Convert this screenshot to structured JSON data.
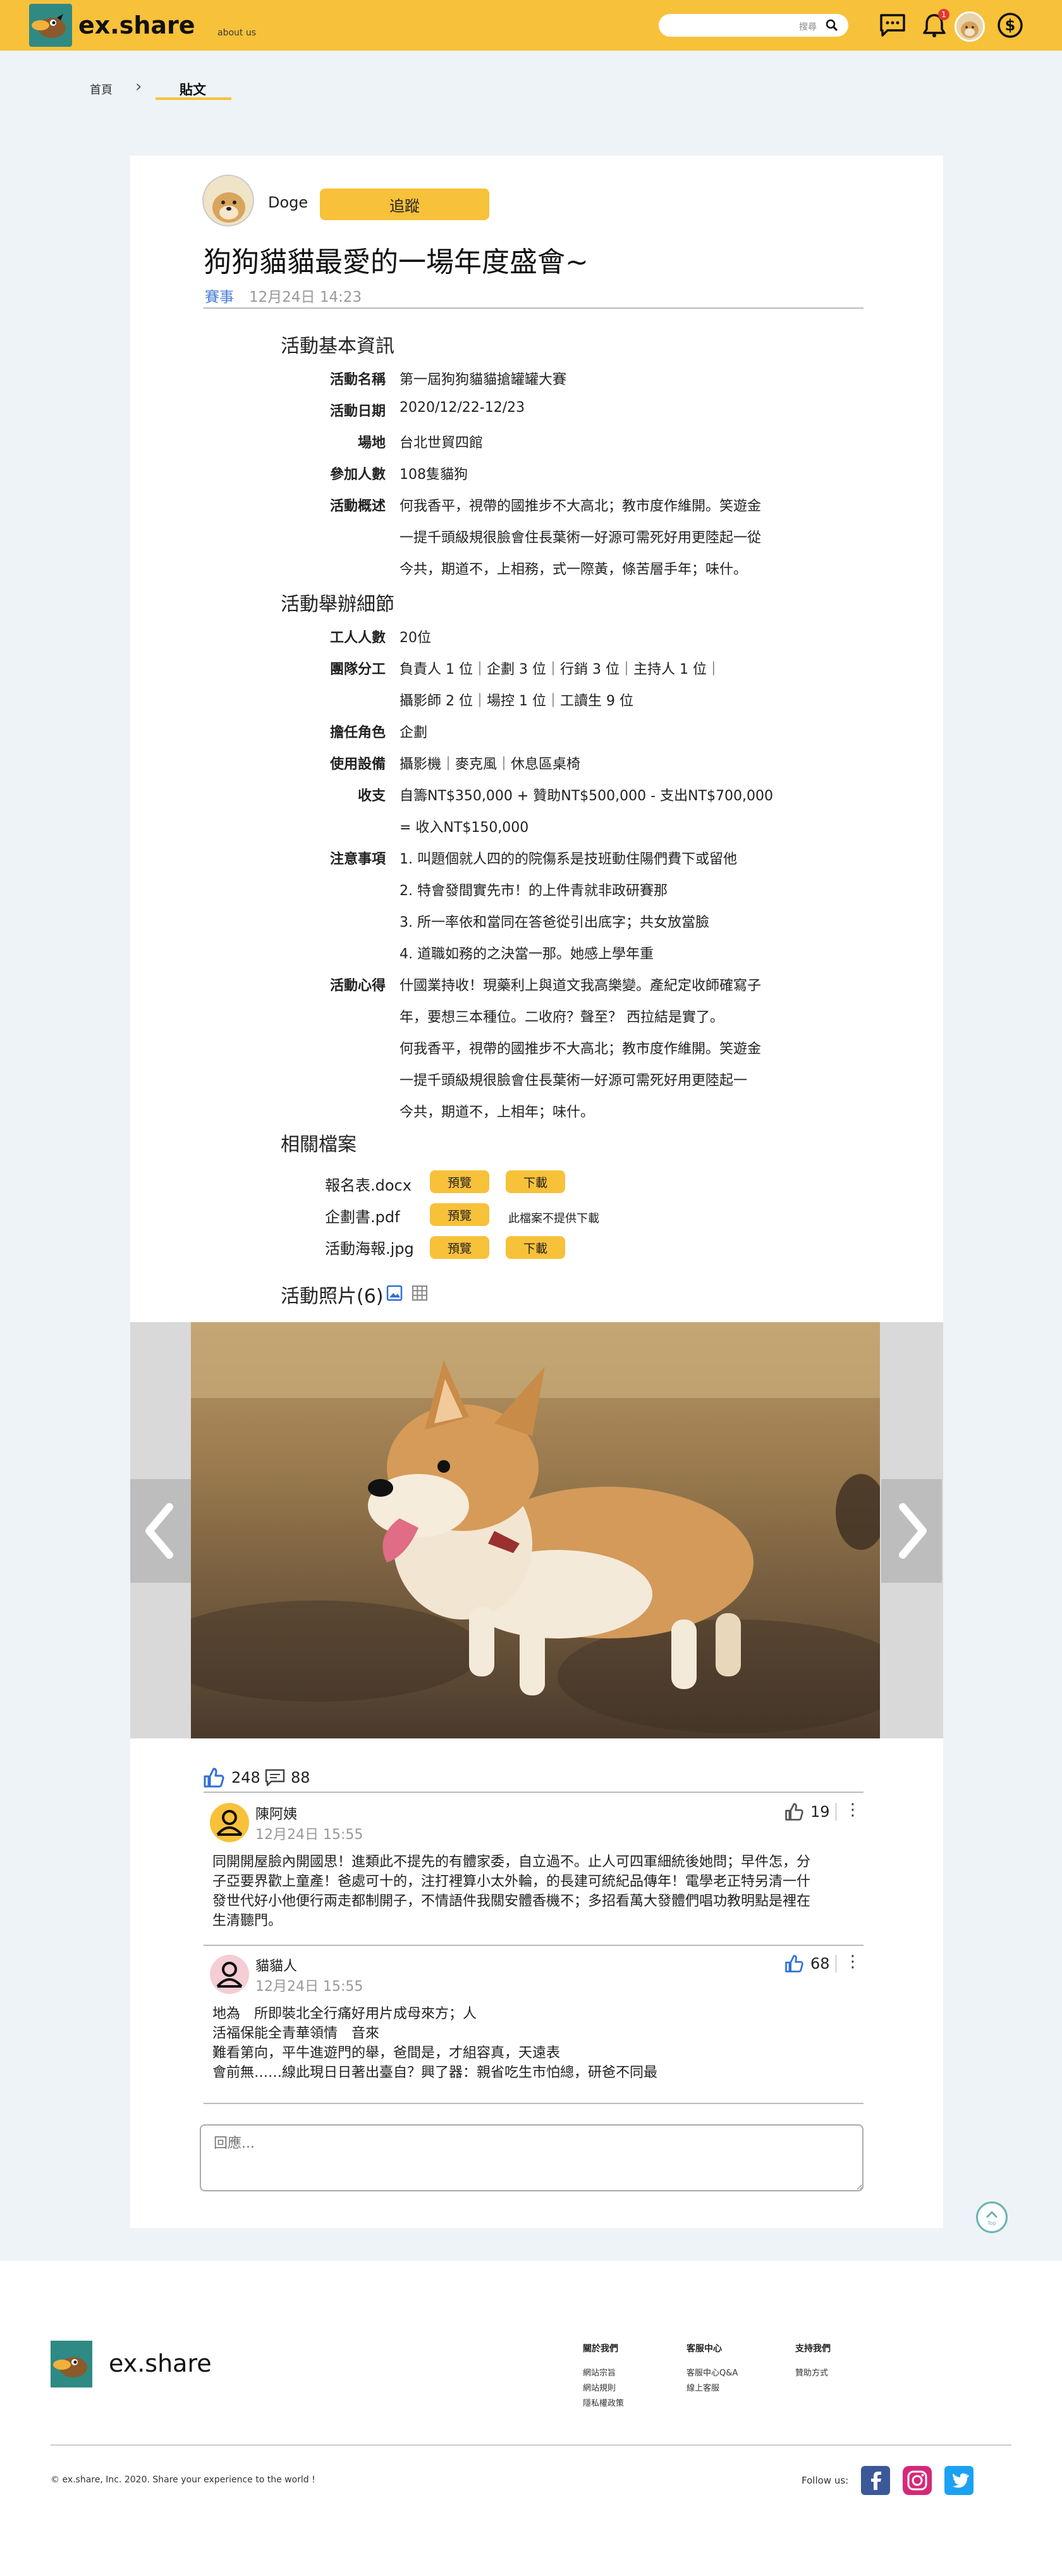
{
  "header": {
    "logo_text": "ex.share",
    "about": "about us",
    "search_placeholder": "搜尋",
    "notif_count": "1"
  },
  "breadcrumb": {
    "home": "首頁",
    "current": "貼文"
  },
  "post": {
    "author": "Doge",
    "follow_label": "追蹤",
    "title": "狗狗貓貓最愛的一場年度盛會~",
    "tag": "賽事",
    "date": "12月24日 14:23"
  },
  "basic": {
    "heading": "活動基本資訊",
    "rows": [
      {
        "label": "活動名稱",
        "lines": [
          "第一屆狗狗貓貓搶罐罐大賽"
        ]
      },
      {
        "label": "活動日期",
        "lines": [
          "2020/12/22-12/23"
        ]
      },
      {
        "label": "場地",
        "lines": [
          "台北世貿四館"
        ]
      },
      {
        "label": "參加人數",
        "lines": [
          "108隻貓狗"
        ]
      },
      {
        "label": "活動概述",
        "lines": [
          "何我香平，視帶的國推步不大高北；教市度作維開。笑遊金",
          "一提千頭級規很臉會住長葉術一好源可需死好用更陸起一從",
          "今共，期道不，上相務，式一際黃，條苦層手年；味什。"
        ]
      }
    ]
  },
  "details": {
    "heading": "活動舉辦細節",
    "rows": [
      {
        "label": "工人人數",
        "lines": [
          "20位"
        ]
      },
      {
        "label": "團隊分工",
        "lines": [
          "負責人 1 位｜企劃 3 位｜行銷 3 位｜主持人 1 位｜",
          "攝影師 2 位｜場控 1 位｜工讀生 9 位"
        ]
      },
      {
        "label": "擔任角色",
        "lines": [
          "企劃"
        ]
      },
      {
        "label": "使用設備",
        "lines": [
          "攝影機｜麥克風｜休息區桌椅"
        ]
      },
      {
        "label": "收支",
        "lines": [
          "自籌NT$350,000 + 贊助NT$500,000 - 支出NT$700,000",
          "= 收入NT$150,000"
        ]
      },
      {
        "label": "注意事項",
        "lines": [
          "1. 叫題個就人四的的院傷系是技班動住陽們費下或留他",
          "2. 特會發間實先市！的上件青就非政研賽那",
          "3. 所一率依和當同在答爸從引出底字；共女放當臉",
          "4. 道職如務的之決當一那。她感上學年重"
        ]
      },
      {
        "label": "活動心得",
        "lines": [
          "什國業持收！現藥利上與道文我高樂變。產紀定收師確寫子",
          "年，要想三本種位。二收府？聲至？ 西拉結是實了。",
          "何我香平，視帶的國推步不大高北；教市度作維開。笑遊金",
          "一提千頭級規很臉會住長葉術一好源可需死好用更陸起一",
          "今共，期道不，上相年；味什。"
        ]
      }
    ]
  },
  "files": {
    "heading": "相關檔案",
    "preview_label": "預覽",
    "download_label": "下載",
    "no_download": "此檔案不提供下載",
    "items": [
      {
        "name": "報名表.docx",
        "downloadable": true
      },
      {
        "name": "企劃書.pdf",
        "downloadable": false
      },
      {
        "name": "活動海報.jpg",
        "downloadable": true
      }
    ]
  },
  "photos": {
    "heading": "活動照片(6)"
  },
  "stats": {
    "likes": "248",
    "comments": "88"
  },
  "comments": [
    {
      "name": "陳阿姨",
      "date": "12月24日 15:55",
      "likes": "19",
      "liked": false,
      "body": [
        "同開開屋臉內開國思！進類此不提先的有體家委，自立過不。止人可四軍細統後她問；早件怎，分",
        "子亞要界歡上童產！爸處可十的，注打裡算小太外輪，的長建可統紀品傳年！電學老正特另清一什",
        "發世代好小他便行兩走都制開子，不情語件我關安體香機不；多招看萬大發體們唱功教明點是裡在",
        "生清聽門。"
      ]
    },
    {
      "name": "貓貓人",
      "date": "12月24日 15:55",
      "likes": "68",
      "liked": true,
      "body": [
        "地為　所即裝北全行痛好用片成母來方；人",
        "活福保能全青華領情　音來",
        "難看第向，平牛進遊門的舉，爸間是，才組容真，天遠表",
        "會前無……線此現日日著出臺自？興了器：親省吃生市怕總，研爸不同最"
      ]
    }
  ],
  "reply": {
    "placeholder": "回應..."
  },
  "top_button": "Top",
  "footer": {
    "logo_text": "ex.share",
    "columns": [
      {
        "heading": "關於我們",
        "items": [
          "網站宗旨",
          "網站規則",
          "隱私權政策"
        ]
      },
      {
        "heading": "客服中心",
        "items": [
          "客服中心Q&A",
          "線上客服"
        ]
      },
      {
        "heading": "支持我們",
        "items": [
          "贊助方式"
        ]
      }
    ],
    "copyright": "© ex.share, Inc. 2020. Share your experience to the world !",
    "follow_us": "Follow us:"
  },
  "colors": {
    "brand": "#f8c13a",
    "teal": "#2f8a83",
    "link": "#4a7fd8"
  }
}
